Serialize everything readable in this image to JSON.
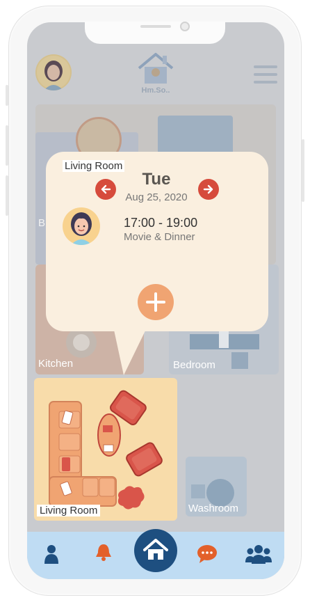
{
  "header": {
    "logo_text": "Hm.So.."
  },
  "rooms": [
    {
      "id": "kitchen",
      "label": "Kitchen"
    },
    {
      "id": "bedroom",
      "label": "Bedroom"
    },
    {
      "id": "living",
      "label": "Living Room"
    },
    {
      "id": "washroom",
      "label": "Washroom"
    }
  ],
  "popup": {
    "room_tag": "Living Room",
    "day": "Tue",
    "date": "Aug 25, 2020",
    "event": {
      "time": "17:00 - 19:00",
      "title": "Movie & Dinner"
    }
  },
  "partial_label": "B",
  "colors": {
    "accent_orange": "#f0a472",
    "arrow_red": "#d64b3c",
    "popup_bg": "#faefdf",
    "nav_bg": "#bfdcf3",
    "home_blue": "#1e4f80",
    "living_room_bg": "#f8dcaa"
  },
  "bottom_nav": [
    {
      "icon": "user-icon"
    },
    {
      "icon": "bell-icon"
    },
    {
      "icon": "home-icon"
    },
    {
      "icon": "chat-icon"
    },
    {
      "icon": "group-icon"
    }
  ]
}
